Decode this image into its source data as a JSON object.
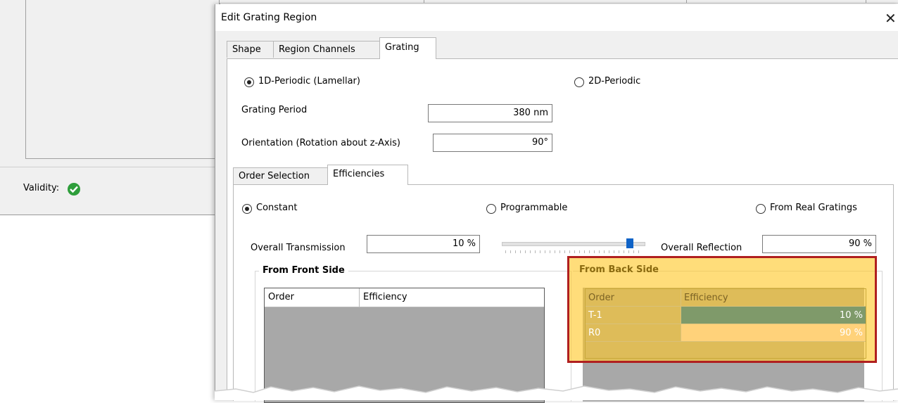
{
  "background_window": {
    "validity_label": "Validity:",
    "validity_icon": "check-circle-icon"
  },
  "dialog": {
    "title": "Edit Grating Region",
    "close_icon": "close-icon",
    "tabs": [
      {
        "label": "Shape",
        "active": false
      },
      {
        "label": "Region Channels",
        "active": false
      },
      {
        "label": "Grating",
        "active": true
      }
    ],
    "grating": {
      "type_options": [
        {
          "label": "1D-Periodic (Lamellar)",
          "selected": true
        },
        {
          "label": "2D-Periodic",
          "selected": false
        }
      ],
      "period": {
        "label": "Grating Period",
        "value": "380 nm"
      },
      "orientation": {
        "label": "Orientation (Rotation about z-Axis)",
        "value": "90°"
      },
      "subtabs": [
        {
          "label": "Order Selection",
          "active": false
        },
        {
          "label": "Efficiencies",
          "active": true
        }
      ],
      "efficiencies": {
        "mode_options": [
          {
            "label": "Constant",
            "selected": true
          },
          {
            "label": "Programmable",
            "selected": false
          },
          {
            "label": "From Real Gratings",
            "selected": false
          }
        ],
        "transmission": {
          "label": "Overall Transmission",
          "value": "10 %"
        },
        "reflection": {
          "label": "Overall Reflection",
          "value": "90 %"
        },
        "slider_fraction": 0.9,
        "front": {
          "title": "From Front Side",
          "columns": [
            "Order",
            "Efficiency"
          ],
          "rows": []
        },
        "back": {
          "title": "From Back Side",
          "columns": [
            "Order",
            "Efficiency"
          ],
          "rows": [
            {
              "order": "T-1",
              "efficiency": "10 %"
            },
            {
              "order": "R0",
              "efficiency": "90 %"
            }
          ]
        }
      }
    }
  },
  "colors": {
    "highlight": "#ffc828",
    "highlight_border": "#b01f1f",
    "selected_cell": "#7f9a6a",
    "slider_thumb": "#0f63c7",
    "check": "#2e9e3b"
  }
}
